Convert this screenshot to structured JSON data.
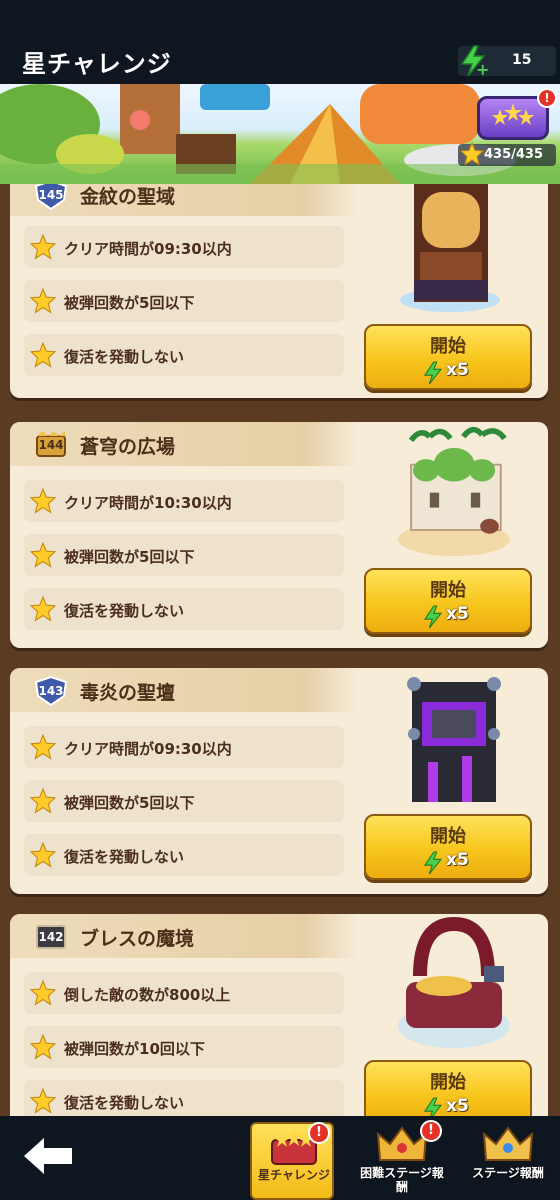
{
  "header": {
    "title": "星チャレンジ",
    "energy": "15",
    "energy_plus": "+"
  },
  "banner": {
    "star_progress": "435/435",
    "alert": "!"
  },
  "cards": [
    {
      "level": "145",
      "title": "金紋の聖域",
      "conditions": [
        "クリア時間が09:30以内",
        "被弾回数が5回以下",
        "復活を発動しない"
      ],
      "button_label": "開始",
      "cost": "x5"
    },
    {
      "level": "144",
      "title": "蒼穹の広場",
      "conditions": [
        "クリア時間が10:30以内",
        "被弾回数が5回以下",
        "復活を発動しない"
      ],
      "button_label": "開始",
      "cost": "x5"
    },
    {
      "level": "143",
      "title": "毒炎の聖壇",
      "conditions": [
        "クリア時間が09:30以内",
        "被弾回数が5回以下",
        "復活を発動しない"
      ],
      "button_label": "開始",
      "cost": "x5"
    },
    {
      "level": "142",
      "title": "ブレスの魔境",
      "conditions": [
        "倒した敵の数が800以上",
        "被弾回数が10回以下",
        "復活を発動しない"
      ],
      "button_label": "開始",
      "cost": "x5"
    }
  ],
  "bottom_nav": {
    "tabs": [
      {
        "label": "星チャレンジ",
        "alert": "!"
      },
      {
        "label": "困難ステージ報酬",
        "alert": "!"
      },
      {
        "label": "ステージ報酬"
      }
    ]
  },
  "colors": {
    "accent_yellow": "#f7c51c",
    "energy_green": "#47d14a",
    "card_bg": "#f6ecd8",
    "alert_red": "#e53228"
  }
}
